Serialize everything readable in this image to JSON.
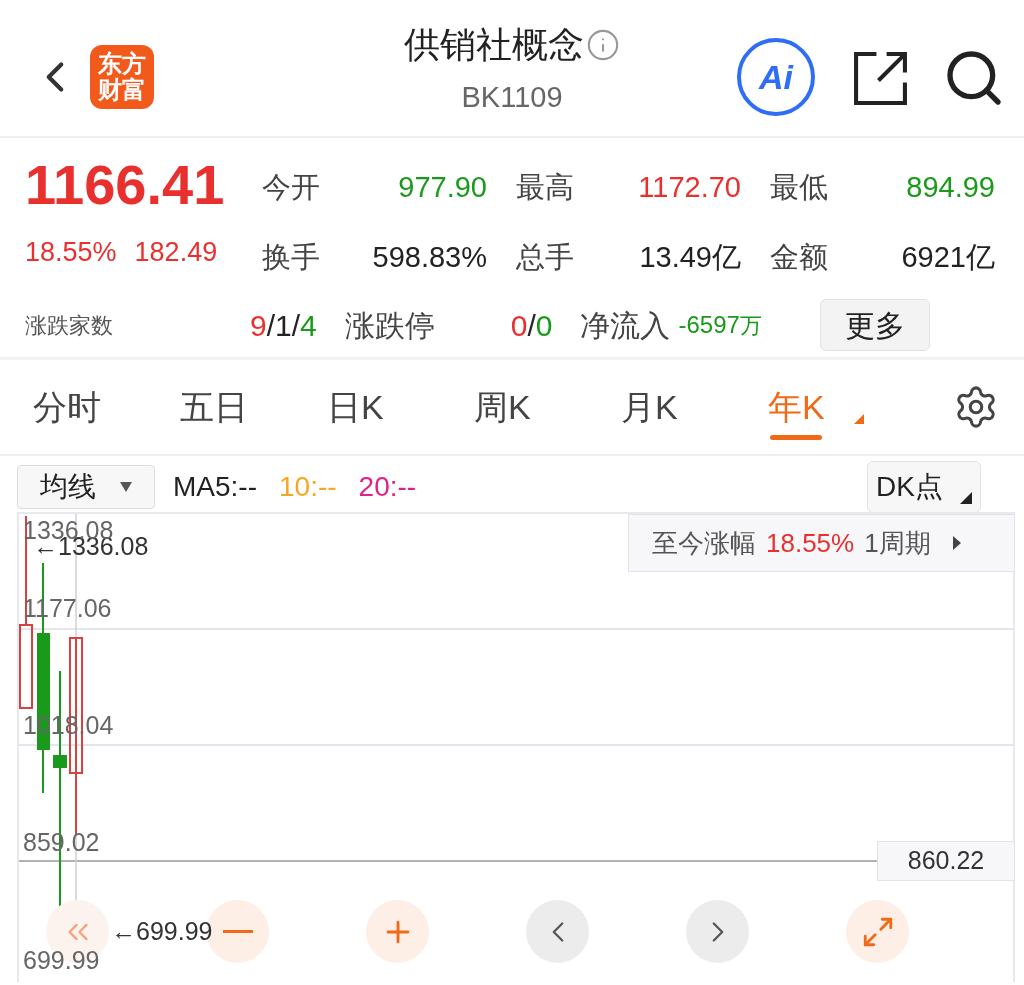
{
  "header": {
    "logo": {
      "lines": [
        "东方",
        "财富"
      ]
    },
    "title": "供销社概念",
    "code": "BK1109",
    "ai_button": "Ai"
  },
  "quote": {
    "price": "1166.41",
    "change_pct": "18.55%",
    "change": "182.49",
    "color": "#e8312f",
    "stats": [
      [
        {
          "label": "今开",
          "value": "977.90",
          "color": "#1a9a1a"
        },
        {
          "label": "最高",
          "value": "1172.70",
          "color": "#e8312f"
        },
        {
          "label": "最低",
          "value": "894.99",
          "color": "#1a9a1a"
        }
      ],
      [
        {
          "label": "换手",
          "value": "598.83%",
          "color": "#222222"
        },
        {
          "label": "总手",
          "value": "13.49亿",
          "color": "#222222"
        },
        {
          "label": "金额",
          "value": "6921亿",
          "color": "#222222"
        }
      ]
    ],
    "breadth": {
      "label": "涨跌家数",
      "parts": [
        {
          "text": "9",
          "color": "#e8312f"
        },
        {
          "text": "/1/",
          "color": "#222222"
        },
        {
          "text": "4",
          "color": "#1a9a1a"
        }
      ]
    },
    "limit": {
      "label": "涨跌停",
      "parts": [
        {
          "text": "0",
          "color": "#e8312f"
        },
        {
          "text": "/",
          "color": "#222222"
        },
        {
          "text": "0",
          "color": "#1a9a1a"
        }
      ]
    },
    "inflow": {
      "label": "净流入",
      "value": "-6597",
      "unit": "万",
      "color": "#1a9a1a"
    },
    "more_button": "更多"
  },
  "tabs": [
    {
      "label": "分时",
      "selected": false,
      "dropdown": false
    },
    {
      "label": "五日",
      "selected": false,
      "dropdown": false
    },
    {
      "label": "日K",
      "selected": false,
      "dropdown": false
    },
    {
      "label": "周K",
      "selected": false,
      "dropdown": false
    },
    {
      "label": "月K",
      "selected": false,
      "dropdown": false
    },
    {
      "label": "年K",
      "selected": true,
      "dropdown": true
    }
  ],
  "indicator_bar": {
    "select": "均线",
    "ma": [
      {
        "text": "MA5:--",
        "color": "#222222"
      },
      {
        "text": "10:--",
        "color": "#f5a623"
      },
      {
        "text": "20:--",
        "color": "#e0218a"
      }
    ],
    "dk_button": "DK点"
  },
  "chart": {
    "y_labels": [
      "1336.08",
      "1177.06",
      "1018.04",
      "859.02",
      "699.99"
    ],
    "high_marker": "←1336.08",
    "low_marker": "←699.99",
    "info": {
      "label": "至今涨幅",
      "value": "18.55%",
      "period": "1周期"
    },
    "price_tag": "860.22",
    "controls": [
      {
        "kind": "rewind",
        "active": false
      },
      {
        "kind": "zoom-out",
        "active": true
      },
      {
        "kind": "zoom-in",
        "active": true
      },
      {
        "kind": "prev",
        "active": false
      },
      {
        "kind": "next",
        "active": false
      },
      {
        "kind": "expand",
        "active": true
      }
    ]
  }
}
